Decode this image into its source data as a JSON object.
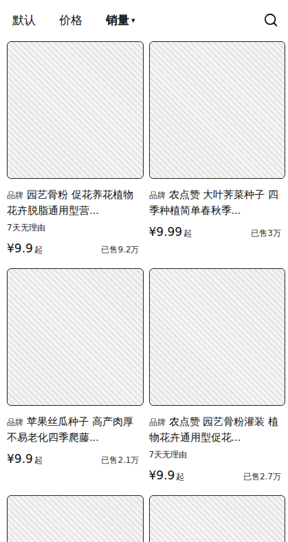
{
  "sort_bar": {
    "tabs": [
      {
        "label": "默认",
        "selected": false,
        "arrow": ""
      },
      {
        "label": "价格",
        "selected": false,
        "arrow": ""
      },
      {
        "label": "销量",
        "selected": true,
        "arrow": "▾"
      }
    ]
  },
  "products": [
    {
      "kind": "full",
      "brand": "品牌",
      "title": "园艺骨粉 促花养花植物花卉脱脂通用型营...",
      "tag": "7天无理由",
      "price": "¥9.9",
      "price_suffix": "起",
      "sold": "已售9.2万"
    },
    {
      "kind": "full",
      "brand": "品牌",
      "title": "农点赞 大叶荠菜种子 四季种植简单春秋季...",
      "tag": "",
      "price": "¥9.99",
      "price_suffix": "起",
      "sold": "已售3万"
    },
    {
      "kind": "full",
      "brand": "品牌",
      "title": "苹果丝瓜种子 高产肉厚不易老化四季爬藤...",
      "tag": "",
      "price": "¥9.9",
      "price_suffix": "起",
      "sold": "已售2.1万"
    },
    {
      "kind": "full",
      "brand": "品牌",
      "title": "农点赞 园艺骨粉灌装 植物花卉通用型促花...",
      "tag": "7天无理由",
      "price": "¥9.9",
      "price_suffix": "起",
      "sold": "已售2.7万"
    },
    {
      "kind": "partial"
    },
    {
      "kind": "partial"
    }
  ]
}
